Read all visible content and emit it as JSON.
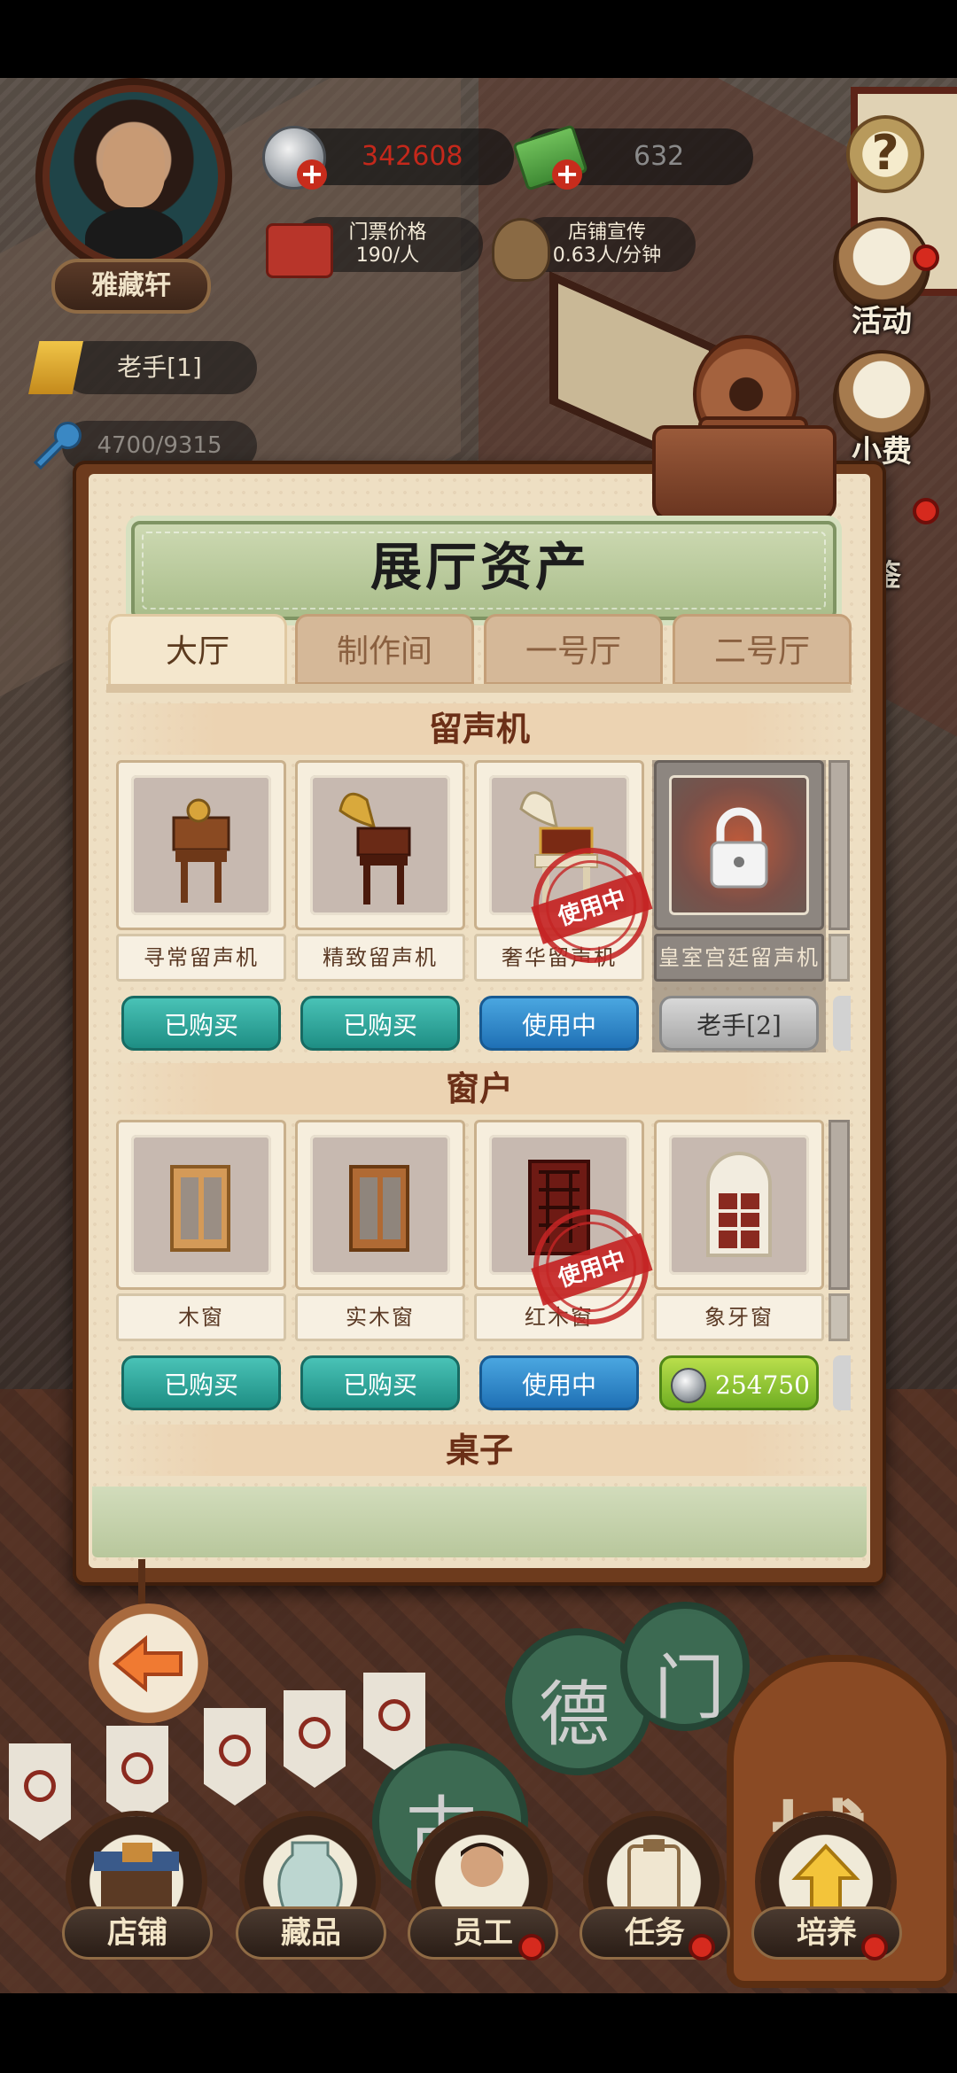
{
  "hud": {
    "player_name": "雅藏轩",
    "coins": "342608",
    "notes": "632",
    "ticket_price_label": "门票价格",
    "ticket_price_value": "190/人",
    "promotion_label": "店铺宣传",
    "promotion_value": "0.63人/分钟",
    "rank": "老手[1]",
    "experience": "4700/9315"
  },
  "side_menu": {
    "help_glyph": "?",
    "events_label": "活动",
    "tips_label": "小费",
    "guide_label": "鉴"
  },
  "panel": {
    "title": "展厅资产",
    "tabs": [
      {
        "label": "大厅"
      },
      {
        "label": "制作间"
      },
      {
        "label": "一号厅"
      },
      {
        "label": "二号厅"
      }
    ],
    "sections": [
      {
        "title": "留声机",
        "items": [
          {
            "name": "寻常留声机",
            "button": "已购买",
            "status": "purchased"
          },
          {
            "name": "精致留声机",
            "button": "已购买",
            "status": "purchased"
          },
          {
            "name": "奢华留声机",
            "button": "使用中",
            "status": "in_use",
            "stamp": "使用中"
          },
          {
            "name": "皇室宫廷留声机",
            "button": "老手[2]",
            "status": "locked"
          }
        ]
      },
      {
        "title": "窗户",
        "items": [
          {
            "name": "木窗",
            "button": "已购买",
            "status": "purchased"
          },
          {
            "name": "实木窗",
            "button": "已购买",
            "status": "purchased"
          },
          {
            "name": "红木窗",
            "button": "使用中",
            "status": "in_use",
            "stamp": "使用中"
          },
          {
            "name": "象牙窗",
            "button": "254750",
            "status": "for_sale"
          }
        ]
      },
      {
        "title": "桌子",
        "items": []
      }
    ]
  },
  "bottom_nav": [
    {
      "label": "店铺",
      "icon": "shop-icon"
    },
    {
      "label": "藏品",
      "icon": "vase-icon"
    },
    {
      "label": "员工",
      "icon": "staff-icon"
    },
    {
      "label": "任务",
      "icon": "task-icon"
    },
    {
      "label": "培养",
      "icon": "upgrade-icon"
    }
  ],
  "scene_signs": {
    "sign_1": "德",
    "sign_2": "门",
    "sign_3": "古",
    "big_sign": "城",
    "left_sign": "古"
  },
  "colors": {
    "accent_red": "#c4281b",
    "button_green": "#1e8e84",
    "button_blue": "#1f70b5",
    "button_lime": "#6fae22",
    "panel_paper": "#eedfc3"
  }
}
